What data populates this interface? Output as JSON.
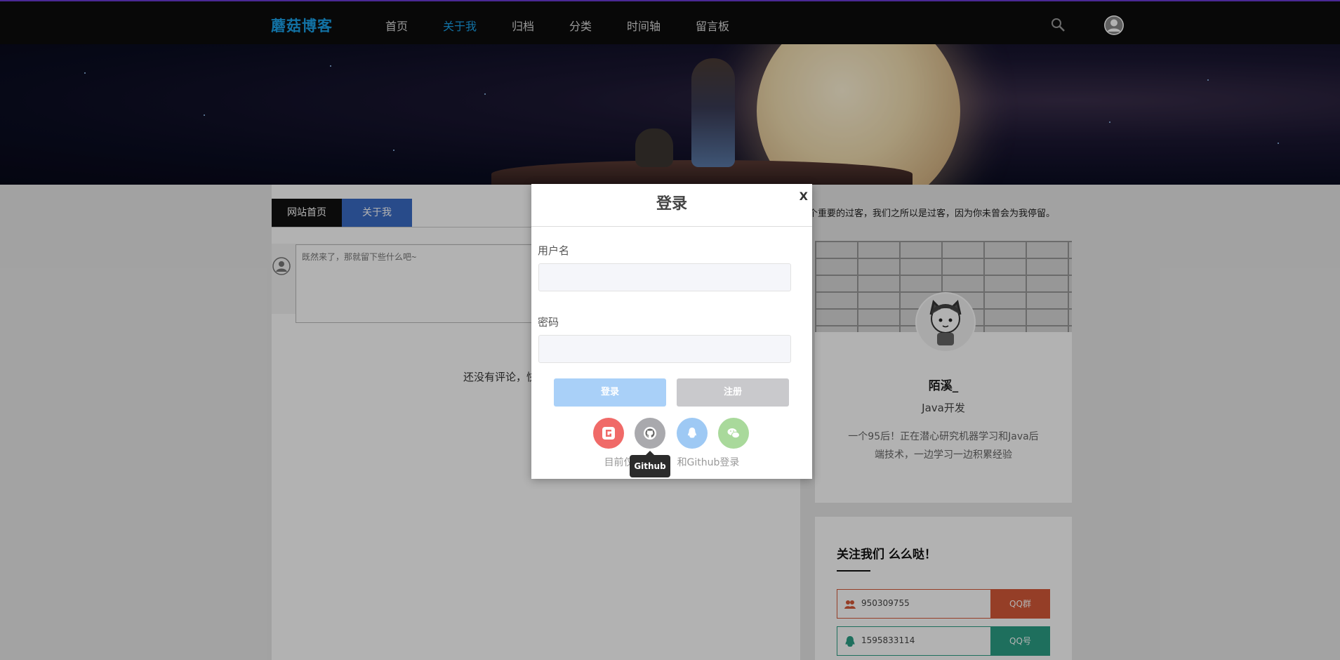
{
  "nav": {
    "logo": "蘑菇博客",
    "items": [
      "首页",
      "关于我",
      "归档",
      "分类",
      "时间轴",
      "留言板"
    ],
    "active": "关于我"
  },
  "tabs": [
    "网站首页",
    "关于我"
  ],
  "comment": {
    "placeholder": "既然来了，那就留下些什么吧~",
    "empty_text_visible": "还没有评论，快"
  },
  "notice": "个重要的过客，我们之所以是过客，因为你未曾会为我停留。",
  "profile": {
    "name": "陌溪_",
    "role": "Java开发",
    "bio": "一个95后！正在潜心研究机器学习和Java后端技术，一边学习一边积累经验"
  },
  "follow": {
    "title": "关注我们 么么哒！",
    "rows": [
      {
        "value": "950309755",
        "button": "QQ群",
        "color": "#d65a38",
        "icon": "users-icon"
      },
      {
        "value": "1595833114",
        "button": "QQ号",
        "color": "#2b9f86",
        "icon": "qq-icon"
      }
    ]
  },
  "modal": {
    "title": "登录",
    "close": "X",
    "username_label": "用户名",
    "password_label": "密码",
    "login_button": "登录",
    "register_button": "注册",
    "hint": "目前仅支持Gitee和Github登录",
    "hint_visible_left": "目前仅",
    "hint_visible_right": "和Github登录",
    "tooltip": "Github",
    "social": [
      {
        "name": "gitee",
        "color": "#f06a68",
        "icon": "gitee-icon"
      },
      {
        "name": "github",
        "color": "#a9a9ad",
        "icon": "github-icon"
      },
      {
        "name": "qq",
        "color": "#9ec9f4",
        "icon": "qq-icon"
      },
      {
        "name": "wechat",
        "color": "#a9d99b",
        "icon": "wechat-icon"
      }
    ]
  }
}
